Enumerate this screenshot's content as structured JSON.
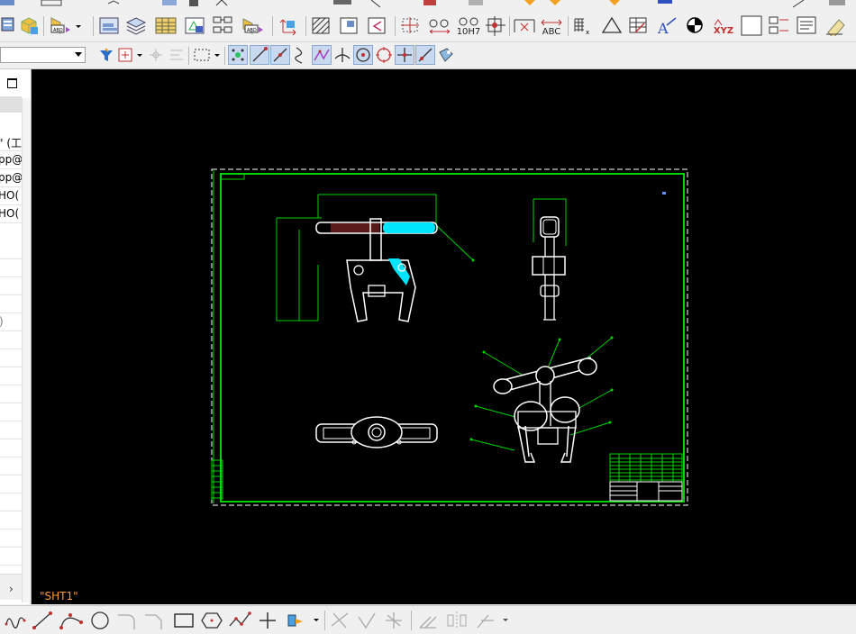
{
  "colors": {
    "canvas_background": "#000000",
    "frame": "#00d400",
    "geometry": "#ffffff",
    "highlight": "#00e5ff",
    "sheet_label": "#ff9b3a"
  },
  "toolbar_main": {
    "tolerance_label": "10H7",
    "text_label": "ABC",
    "coordinate_label": "XYZ"
  },
  "snap_toolbar": {
    "layer_combo": {
      "value": ""
    }
  },
  "model_tree": {
    "rows": [
      {
        "text": "\" (工"
      },
      {
        "text": "pp@"
      },
      {
        "text": "pp@"
      },
      {
        "text": "HO("
      },
      {
        "text": "HO("
      }
    ],
    "misc_text": ")"
  },
  "canvas": {
    "sheet_name": "\"SHT1\""
  }
}
